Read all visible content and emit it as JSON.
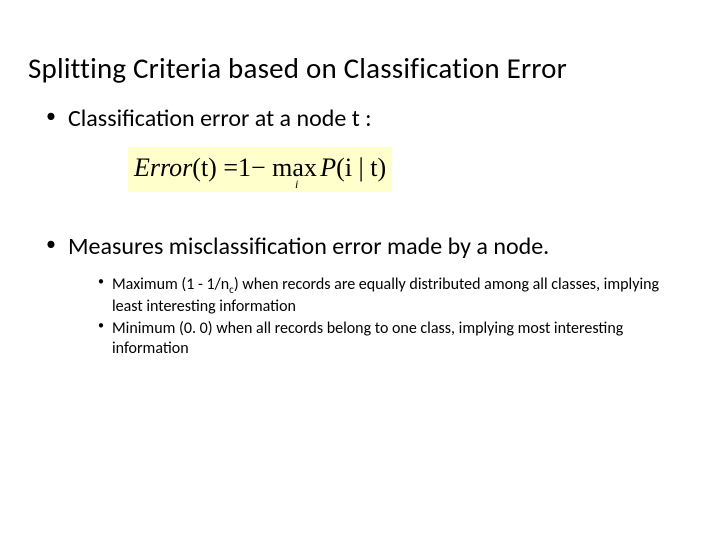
{
  "slide": {
    "title": "Splitting Criteria based on Classification Error",
    "bullet1": "Classification error at a node t :",
    "formula": {
      "lhs": "Error",
      "arg": "(t)",
      "eq": "=",
      "one": "1",
      "minus": "−",
      "max": "max",
      "i": "i",
      "P": "P",
      "cond": "(i | t)"
    },
    "bullet2": "Measures misclassification error made by a node.",
    "sub1_a": "Maximum (1 - 1/n",
    "sub1_c": "c",
    "sub1_b": ") when records are equally distributed among all classes, implying least interesting information",
    "sub2": "Minimum (0. 0) when all records belong to one class, implying most interesting information"
  }
}
